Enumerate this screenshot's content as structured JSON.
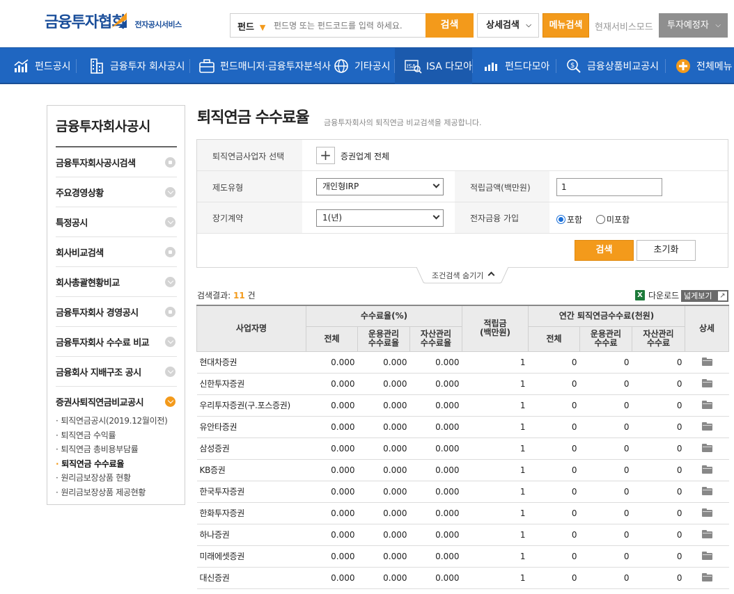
{
  "header": {
    "logo_main": "금융투자협회",
    "logo_sub": "전자공시서비스",
    "search_category": "펀드",
    "search_placeholder": "펀드명 또는 펀드코드를 입력 하세요.",
    "search_button": "검색",
    "detail_search": "상세검색",
    "menu_search": "메뉴검색",
    "service_mode": "현재서비스모드",
    "investor_mode": "투자예정자"
  },
  "nav": {
    "items": [
      {
        "label": "펀드공시",
        "icon": "chart-icon"
      },
      {
        "label": "금융투자 회사공시",
        "icon": "building-icon"
      },
      {
        "label": "펀드매니저·금융투자분석사",
        "icon": "briefcase-icon"
      },
      {
        "label": "기타공시",
        "icon": "globe-icon"
      },
      {
        "label": "ISA 다모아",
        "icon": "isa-icon"
      },
      {
        "label": "펀드다모아",
        "icon": "bars-icon"
      },
      {
        "label": "금융상품비교공시",
        "icon": "coin-search-icon"
      },
      {
        "label": "전체메뉴",
        "icon": "plus-circle-icon"
      }
    ]
  },
  "sidebar": {
    "title": "금융투자회사공시",
    "items": [
      {
        "label": "금융투자회사공시검색"
      },
      {
        "label": "주요경영상황"
      },
      {
        "label": "특정공시"
      },
      {
        "label": "회사비교검색"
      },
      {
        "label": "회사총괄현황비교"
      },
      {
        "label": "금융투자회사 경영공시"
      },
      {
        "label": "금융투자회사 수수료 비교"
      },
      {
        "label": "금융회사 지배구조 공시"
      },
      {
        "label": "증권사퇴직연금비교공시"
      }
    ],
    "sub_items": [
      {
        "label": "퇴직연금공시(2019.12월이전)"
      },
      {
        "label": "퇴직연금 수익률"
      },
      {
        "label": "퇴직연금 총비용부담률"
      },
      {
        "label": "퇴직연금 수수료율"
      },
      {
        "label": "원리금보장상품 현황"
      },
      {
        "label": "원리금보장상품 제공현황"
      }
    ]
  },
  "page": {
    "title": "퇴직연금 수수료율",
    "description": "금융투자회사의 퇴직연금 비교검색을 제공합니다."
  },
  "filter": {
    "provider_label": "퇴직연금사업자 선택",
    "provider_value": "증권업계 전체",
    "system_label": "제도유형",
    "system_value": "개인형IRP",
    "amount_label": "적립금액(백만원)",
    "amount_value": "1",
    "contract_label": "장기계약",
    "contract_value": "1(년)",
    "efin_label": "전자금융 가입",
    "efin_include": "포함",
    "efin_exclude": "미포함",
    "search_button": "검색",
    "reset_button": "초기화",
    "toggle_label": "조건검색 숨기기"
  },
  "results": {
    "count_prefix": "검색결과:",
    "count": "11",
    "count_suffix": "건",
    "download": "다운로드",
    "wide_view": "넓게보기"
  },
  "table": {
    "headers": {
      "company": "사업자명",
      "fee_rate": "수수료율(%)",
      "total": "전체",
      "mgmt_rate": "운용관리\n수수료율",
      "asset_rate": "자산관리\n수수료율",
      "reserve": "적립금\n(백만원)",
      "annual_fee": "연간 퇴직연금수수료(천원)",
      "total2": "전체",
      "mgmt_fee": "운용관리\n수수료",
      "asset_fee": "자산관리\n수수료",
      "detail": "상세"
    },
    "rows": [
      {
        "company": "현대차증권",
        "total": "0.000",
        "mgmt": "0.000",
        "asset": "0.000",
        "reserve": "1",
        "fee_total": "0",
        "fee_mgmt": "0",
        "fee_asset": "0"
      },
      {
        "company": "신한투자증권",
        "total": "0.000",
        "mgmt": "0.000",
        "asset": "0.000",
        "reserve": "1",
        "fee_total": "0",
        "fee_mgmt": "0",
        "fee_asset": "0"
      },
      {
        "company": "우리투자증권(구.포스증권)",
        "total": "0.000",
        "mgmt": "0.000",
        "asset": "0.000",
        "reserve": "1",
        "fee_total": "0",
        "fee_mgmt": "0",
        "fee_asset": "0"
      },
      {
        "company": "유안타증권",
        "total": "0.000",
        "mgmt": "0.000",
        "asset": "0.000",
        "reserve": "1",
        "fee_total": "0",
        "fee_mgmt": "0",
        "fee_asset": "0"
      },
      {
        "company": "삼성증권",
        "total": "0.000",
        "mgmt": "0.000",
        "asset": "0.000",
        "reserve": "1",
        "fee_total": "0",
        "fee_mgmt": "0",
        "fee_asset": "0"
      },
      {
        "company": "KB증권",
        "total": "0.000",
        "mgmt": "0.000",
        "asset": "0.000",
        "reserve": "1",
        "fee_total": "0",
        "fee_mgmt": "0",
        "fee_asset": "0"
      },
      {
        "company": "한국투자증권",
        "total": "0.000",
        "mgmt": "0.000",
        "asset": "0.000",
        "reserve": "1",
        "fee_total": "0",
        "fee_mgmt": "0",
        "fee_asset": "0"
      },
      {
        "company": "한화투자증권",
        "total": "0.000",
        "mgmt": "0.000",
        "asset": "0.000",
        "reserve": "1",
        "fee_total": "0",
        "fee_mgmt": "0",
        "fee_asset": "0"
      },
      {
        "company": "하나증권",
        "total": "0.000",
        "mgmt": "0.000",
        "asset": "0.000",
        "reserve": "1",
        "fee_total": "0",
        "fee_mgmt": "0",
        "fee_asset": "0"
      },
      {
        "company": "미래에셋증권",
        "total": "0.000",
        "mgmt": "0.000",
        "asset": "0.000",
        "reserve": "1",
        "fee_total": "0",
        "fee_mgmt": "0",
        "fee_asset": "0"
      },
      {
        "company": "대신증권",
        "total": "0.000",
        "mgmt": "0.000",
        "asset": "0.000",
        "reserve": "1",
        "fee_total": "0",
        "fee_mgmt": "0",
        "fee_asset": "0"
      }
    ]
  },
  "colors": {
    "accent_orange": "#f39a1b",
    "nav_blue": "#1f66c1",
    "logo_blue": "#1a4e9a"
  }
}
